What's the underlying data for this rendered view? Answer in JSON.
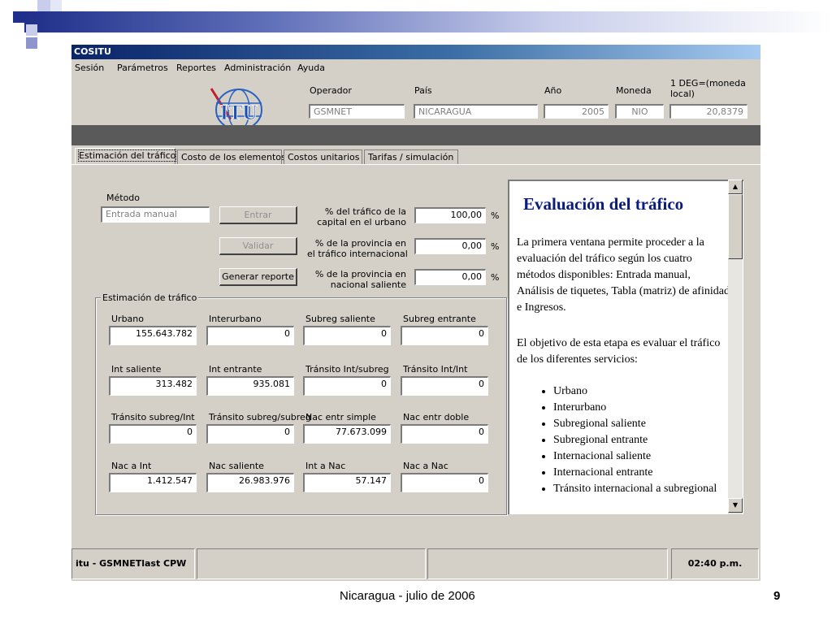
{
  "window": {
    "title": "COSITU"
  },
  "menu": [
    "Sesión",
    "Parámetros",
    "Reportes",
    "Administración",
    "Ayuda"
  ],
  "header": {
    "operador_label": "Operador",
    "operador": "GSMNET",
    "pais_label": "País",
    "pais": "NICARAGUA",
    "anio_label": "Año",
    "anio": "2005",
    "moneda_label": "Moneda",
    "moneda": "NIO",
    "deg_label_1": "1 DEG=(moneda",
    "deg_label_2": "local)",
    "deg": "20,8379",
    "logo_text": "ITU"
  },
  "tabs": [
    "Estimación del tráfico",
    "Costo de los elementos",
    "Costos unitarios",
    "Tarifas / simulación"
  ],
  "metodo": {
    "label": "Método",
    "value": "Entrada manual",
    "entrar": "Entrar",
    "validar": "Validar",
    "generar": "Generar reporte"
  },
  "percent": [
    {
      "l1": "% del tráfico de la",
      "l2": "capital en el urbano",
      "value": "100,00",
      "unit": "%"
    },
    {
      "l1": "% de la provincia en",
      "l2": "el tráfico internacional",
      "value": "0,00",
      "unit": "%"
    },
    {
      "l1": "% de la provincia en",
      "l2": "nacional saliente",
      "value": "0,00",
      "unit": "%"
    }
  ],
  "estimacion": {
    "title": "Estimación de tráfico",
    "fields": [
      {
        "label": "Urbano",
        "value": "155.643.782"
      },
      {
        "label": "Interurbano",
        "value": "0"
      },
      {
        "label": "Subreg saliente",
        "value": "0"
      },
      {
        "label": "Subreg entrante",
        "value": "0"
      },
      {
        "label": "Int saliente",
        "value": "313.482"
      },
      {
        "label": "Int entrante",
        "value": "935.081"
      },
      {
        "label": "Tránsito Int/subreg",
        "value": "0"
      },
      {
        "label": "Tránsito Int/Int",
        "value": "0"
      },
      {
        "label": "Tránsito subreg/Int",
        "value": "0"
      },
      {
        "label": "Tránsito subreg/subreg",
        "value": "0"
      },
      {
        "label": "Nac entr simple",
        "value": "77.673.099"
      },
      {
        "label": "Nac entr doble",
        "value": "0"
      },
      {
        "label": "Nac a Int",
        "value": "1.412.547"
      },
      {
        "label": "Nac saliente",
        "value": "26.983.976"
      },
      {
        "label": "Int a Nac",
        "value": "57.147"
      },
      {
        "label": "Nac a Nac",
        "value": "0"
      }
    ]
  },
  "doc": {
    "title": "Evaluación del tráfico",
    "p1": "La primera ventana permite proceder a la evaluación del tráfico según los cuatro métodos disponibles: Entrada manual, Análisis de tiquetes, Tabla (matriz) de afinidad e Ingresos.",
    "p2": "El objetivo de esta etapa es evaluar el tráfico de los diferentes servicios:",
    "items": [
      "Urbano",
      "Interurbano",
      "Subregional saliente",
      "Subregional entrante",
      "Internacional saliente",
      "Internacional entrante",
      "Tránsito internacional a subregional"
    ]
  },
  "status": {
    "left": "itu - GSMNETlast CPW",
    "time": "02:40 p.m."
  },
  "footer": {
    "center": "Nicaragua - julio de 2006",
    "page": "9"
  },
  "colors": {
    "title_blue": "#0b1d7a",
    "window_gray": "#d4d0c8",
    "titlebar": "#0a246a"
  }
}
